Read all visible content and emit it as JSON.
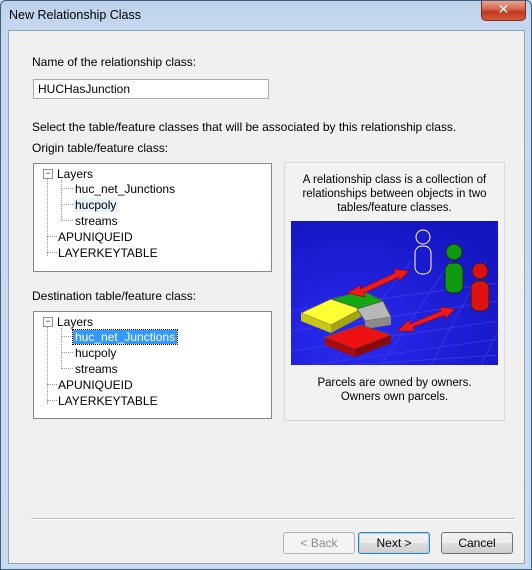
{
  "window": {
    "title": "New Relationship Class",
    "close_glyph": "✕"
  },
  "name_label": "Name of the relationship class:",
  "name_value": "HUCHasJunction",
  "select_instruction": "Select the table/feature classes that will be associated by this relationship class.",
  "origin": {
    "label": "Origin table/feature class:",
    "tree": {
      "root": "Layers",
      "children": [
        "huc_net_Junctions",
        "hucpoly",
        "streams"
      ],
      "tables": [
        "APUNIQUEID",
        "LAYERKEYTABLE"
      ],
      "highlighted": "hucpoly"
    }
  },
  "destination": {
    "label": "Destination table/feature class:",
    "tree": {
      "root": "Layers",
      "children": [
        "huc_net_Junctions",
        "hucpoly",
        "streams"
      ],
      "tables": [
        "APUNIQUEID",
        "LAYERKEYTABLE"
      ],
      "selected": "huc_net_Junctions"
    }
  },
  "info_panel": {
    "top_text": [
      "A relationship class is a collection of",
      "relationships between objects in two",
      "tables/feature classes."
    ],
    "bottom_text": [
      "Parcels are owned by owners.",
      "Owners own parcels."
    ],
    "illustration_icon": "parcels-owners-relationship-illustration"
  },
  "buttons": {
    "back": "< Back",
    "next": "Next >",
    "cancel": "Cancel"
  },
  "colors": {
    "selection": "#3399ff",
    "illustration_bg": "#1c1cd9"
  }
}
